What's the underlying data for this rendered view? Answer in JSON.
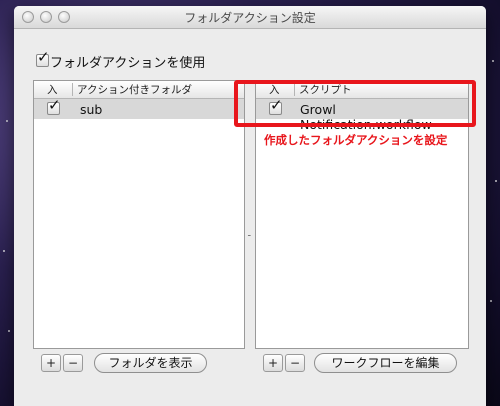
{
  "window": {
    "title": "フォルダアクション設定"
  },
  "main_toggle": {
    "label": "フォルダアクションを使用",
    "checked": true
  },
  "folders_table": {
    "columns": [
      "入",
      "アクション付きフォルダ"
    ],
    "rows": [
      {
        "enabled": true,
        "name": "sub",
        "selected": true
      }
    ]
  },
  "scripts_table": {
    "columns": [
      "入",
      "スクリプト"
    ],
    "rows": [
      {
        "enabled": true,
        "name": "Growl Notification.workflow",
        "selected": true
      }
    ]
  },
  "left_buttons": {
    "add": "+",
    "remove": "−",
    "show_folder": "フォルダを表示"
  },
  "right_buttons": {
    "add": "+",
    "remove": "−",
    "edit_workflow": "ワークフローを編集"
  },
  "annotation": {
    "text": "作成したフォルダアクションを設定",
    "color": "#e8161c"
  },
  "glyphs": {
    "check": "✓",
    "resize_handle": "⁃"
  }
}
